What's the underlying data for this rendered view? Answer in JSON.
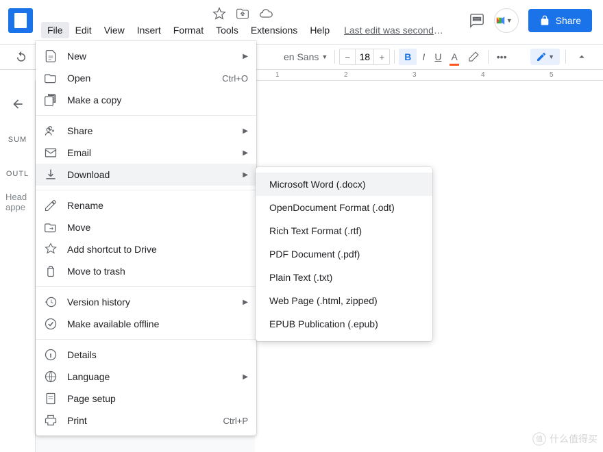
{
  "header": {
    "last_edit": "Last edit was seconds …"
  },
  "menubar": [
    "File",
    "Edit",
    "View",
    "Insert",
    "Format",
    "Tools",
    "Extensions",
    "Help"
  ],
  "share_label": "Share",
  "toolbar": {
    "font": "en Sans",
    "size": "18"
  },
  "ruler_ticks": [
    "1",
    "2",
    "3",
    "4",
    "5"
  ],
  "sidebar": {
    "summary": "SUM",
    "outline": "OUTL",
    "outline_hint": "Head\nappe"
  },
  "file_menu": [
    {
      "icon": "doc",
      "label": "New",
      "arrow": true
    },
    {
      "icon": "folder",
      "label": "Open",
      "shortcut": "Ctrl+O"
    },
    {
      "icon": "copy",
      "label": "Make a copy"
    },
    {
      "sep": true
    },
    {
      "icon": "share",
      "label": "Share",
      "arrow": true
    },
    {
      "icon": "email",
      "label": "Email",
      "arrow": true
    },
    {
      "icon": "download",
      "label": "Download",
      "arrow": true,
      "hov": true
    },
    {
      "sep": true
    },
    {
      "icon": "rename",
      "label": "Rename"
    },
    {
      "icon": "move",
      "label": "Move"
    },
    {
      "icon": "shortcut",
      "label": "Add shortcut to Drive"
    },
    {
      "icon": "trash",
      "label": "Move to trash"
    },
    {
      "sep": true
    },
    {
      "icon": "history",
      "label": "Version history",
      "arrow": true
    },
    {
      "icon": "offline",
      "label": "Make available offline"
    },
    {
      "sep": true
    },
    {
      "icon": "info",
      "label": "Details"
    },
    {
      "icon": "globe",
      "label": "Language",
      "arrow": true
    },
    {
      "icon": "page",
      "label": "Page setup"
    },
    {
      "icon": "print",
      "label": "Print",
      "shortcut": "Ctrl+P"
    }
  ],
  "download_menu": [
    "Microsoft Word (.docx)",
    "OpenDocument Format (.odt)",
    "Rich Text Format (.rtf)",
    "PDF Document (.pdf)",
    "Plain Text (.txt)",
    "Web Page (.html, zipped)",
    "EPUB Publication (.epub)"
  ],
  "watermark": "什么值得买"
}
